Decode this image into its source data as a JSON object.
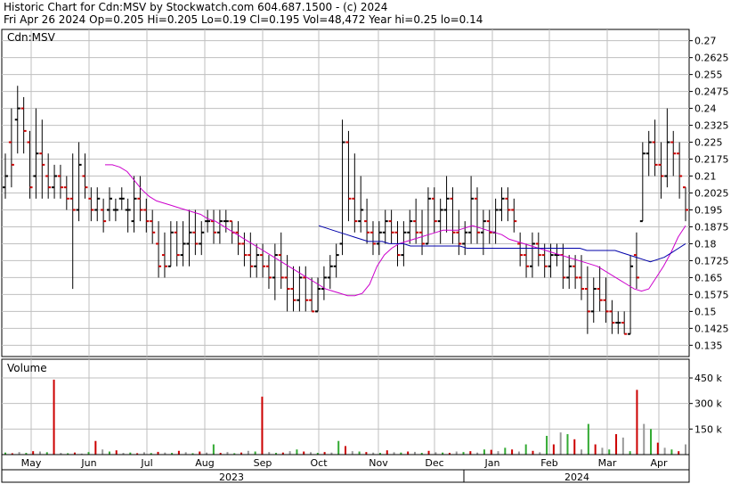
{
  "header": {
    "line1": "Historic Chart for Cdn:MSV by Stockwatch.com 604.687.1500 - (c) 2024",
    "line2": "Fri Apr 26 2024   Op=0.205  Hi=0.205  Lo=0.19  Cl=0.195  Vol=48,472  Year hi=0.25  lo=0.14"
  },
  "colors": {
    "up": "#000000",
    "down": "#cc0000",
    "ma_short": "#cc00cc",
    "ma_long": "#0000aa",
    "grid": "#bfbfbf",
    "vol_up": "#33aa33",
    "vol_down": "#cc0000",
    "vol_neutral": "#999999"
  },
  "chart_data": [
    {
      "type": "ohlc",
      "title": "Cdn:MSV",
      "ylim": [
        0.13,
        0.275
      ],
      "y_ticks": [
        "0.27",
        "0.2625",
        "0.255",
        "0.2475",
        "0.24",
        "0.2325",
        "0.225",
        "0.2175",
        "0.21",
        "0.2025",
        "0.195",
        "0.1875",
        "0.18",
        "0.1725",
        "0.165",
        "0.1575",
        "0.15",
        "0.1425",
        "0.135"
      ],
      "x_labels": [
        "May",
        "Jun",
        "Jul",
        "Aug",
        "Sep",
        "Oct",
        "Nov",
        "Dec",
        "Jan",
        "Feb",
        "Mar",
        "Apr"
      ],
      "years": [
        "2023",
        "2024"
      ],
      "bars": [
        [
          0.205,
          0.22,
          0.2,
          0.21
        ],
        [
          0.225,
          0.24,
          0.205,
          0.215
        ],
        [
          0.235,
          0.25,
          0.22,
          0.24
        ],
        [
          0.24,
          0.245,
          0.22,
          0.23
        ],
        [
          0.225,
          0.23,
          0.2,
          0.205
        ],
        [
          0.21,
          0.24,
          0.2,
          0.22
        ],
        [
          0.22,
          0.235,
          0.2,
          0.215
        ],
        [
          0.21,
          0.22,
          0.2,
          0.205
        ],
        [
          0.205,
          0.215,
          0.2,
          0.21
        ],
        [
          0.21,
          0.215,
          0.2,
          0.205
        ],
        [
          0.205,
          0.21,
          0.195,
          0.2
        ],
        [
          0.2,
          0.22,
          0.16,
          0.195
        ],
        [
          0.195,
          0.225,
          0.19,
          0.215
        ],
        [
          0.21,
          0.22,
          0.2,
          0.205
        ],
        [
          0.2,
          0.205,
          0.19,
          0.195
        ],
        [
          0.195,
          0.205,
          0.19,
          0.2
        ],
        [
          0.195,
          0.2,
          0.185,
          0.19
        ],
        [
          0.195,
          0.205,
          0.19,
          0.2
        ],
        [
          0.195,
          0.2,
          0.19,
          0.195
        ],
        [
          0.2,
          0.205,
          0.195,
          0.2
        ],
        [
          0.195,
          0.2,
          0.185,
          0.195
        ],
        [
          0.19,
          0.21,
          0.185,
          0.2
        ],
        [
          0.2,
          0.21,
          0.19,
          0.195
        ],
        [
          0.195,
          0.2,
          0.185,
          0.19
        ],
        [
          0.19,
          0.195,
          0.18,
          0.185
        ],
        [
          0.18,
          0.19,
          0.165,
          0.17
        ],
        [
          0.175,
          0.185,
          0.165,
          0.17
        ],
        [
          0.17,
          0.19,
          0.17,
          0.185
        ],
        [
          0.185,
          0.19,
          0.17,
          0.175
        ],
        [
          0.175,
          0.19,
          0.17,
          0.18
        ],
        [
          0.18,
          0.195,
          0.17,
          0.185
        ],
        [
          0.185,
          0.195,
          0.175,
          0.18
        ],
        [
          0.18,
          0.19,
          0.175,
          0.185
        ],
        [
          0.19,
          0.195,
          0.185,
          0.19
        ],
        [
          0.19,
          0.195,
          0.18,
          0.185
        ],
        [
          0.185,
          0.195,
          0.18,
          0.19
        ],
        [
          0.19,
          0.195,
          0.185,
          0.19
        ],
        [
          0.19,
          0.19,
          0.18,
          0.185
        ],
        [
          0.185,
          0.19,
          0.175,
          0.18
        ],
        [
          0.18,
          0.185,
          0.17,
          0.175
        ],
        [
          0.175,
          0.185,
          0.165,
          0.17
        ],
        [
          0.17,
          0.18,
          0.165,
          0.175
        ],
        [
          0.175,
          0.18,
          0.165,
          0.17
        ],
        [
          0.17,
          0.175,
          0.16,
          0.165
        ],
        [
          0.165,
          0.18,
          0.155,
          0.175
        ],
        [
          0.175,
          0.185,
          0.16,
          0.165
        ],
        [
          0.165,
          0.175,
          0.15,
          0.16
        ],
        [
          0.16,
          0.17,
          0.15,
          0.155
        ],
        [
          0.155,
          0.17,
          0.15,
          0.165
        ],
        [
          0.165,
          0.17,
          0.15,
          0.155
        ],
        [
          0.155,
          0.165,
          0.15,
          0.15
        ],
        [
          0.15,
          0.165,
          0.15,
          0.16
        ],
        [
          0.16,
          0.17,
          0.155,
          0.165
        ],
        [
          0.165,
          0.175,
          0.16,
          0.17
        ],
        [
          0.17,
          0.18,
          0.165,
          0.175
        ],
        [
          0.18,
          0.235,
          0.175,
          0.225
        ],
        [
          0.225,
          0.23,
          0.19,
          0.2
        ],
        [
          0.2,
          0.22,
          0.185,
          0.19
        ],
        [
          0.19,
          0.21,
          0.185,
          0.195
        ],
        [
          0.19,
          0.2,
          0.18,
          0.185
        ],
        [
          0.185,
          0.19,
          0.175,
          0.18
        ],
        [
          0.18,
          0.19,
          0.175,
          0.185
        ],
        [
          0.185,
          0.195,
          0.18,
          0.19
        ],
        [
          0.19,
          0.195,
          0.18,
          0.185
        ],
        [
          0.185,
          0.19,
          0.17,
          0.175
        ],
        [
          0.175,
          0.19,
          0.17,
          0.185
        ],
        [
          0.185,
          0.195,
          0.18,
          0.19
        ],
        [
          0.19,
          0.2,
          0.18,
          0.185
        ],
        [
          0.185,
          0.195,
          0.175,
          0.18
        ],
        [
          0.18,
          0.205,
          0.18,
          0.2
        ],
        [
          0.2,
          0.205,
          0.185,
          0.19
        ],
        [
          0.19,
          0.2,
          0.18,
          0.195
        ],
        [
          0.195,
          0.21,
          0.185,
          0.2
        ],
        [
          0.2,
          0.205,
          0.18,
          0.185
        ],
        [
          0.185,
          0.195,
          0.175,
          0.18
        ],
        [
          0.18,
          0.19,
          0.175,
          0.185
        ],
        [
          0.185,
          0.21,
          0.18,
          0.2
        ],
        [
          0.2,
          0.205,
          0.18,
          0.185
        ],
        [
          0.185,
          0.195,
          0.175,
          0.19
        ],
        [
          0.19,
          0.195,
          0.18,
          0.185
        ],
        [
          0.185,
          0.2,
          0.18,
          0.195
        ],
        [
          0.195,
          0.205,
          0.19,
          0.2
        ],
        [
          0.2,
          0.205,
          0.19,
          0.195
        ],
        [
          0.195,
          0.2,
          0.185,
          0.19
        ],
        [
          0.18,
          0.185,
          0.17,
          0.175
        ],
        [
          0.175,
          0.18,
          0.165,
          0.17
        ],
        [
          0.17,
          0.185,
          0.165,
          0.18
        ],
        [
          0.18,
          0.185,
          0.17,
          0.175
        ],
        [
          0.175,
          0.18,
          0.165,
          0.17
        ],
        [
          0.17,
          0.18,
          0.165,
          0.175
        ],
        [
          0.175,
          0.18,
          0.17,
          0.175
        ],
        [
          0.175,
          0.18,
          0.16,
          0.165
        ],
        [
          0.165,
          0.175,
          0.16,
          0.17
        ],
        [
          0.17,
          0.175,
          0.16,
          0.165
        ],
        [
          0.165,
          0.175,
          0.155,
          0.16
        ],
        [
          0.16,
          0.17,
          0.14,
          0.15
        ],
        [
          0.15,
          0.165,
          0.145,
          0.16
        ],
        [
          0.16,
          0.17,
          0.15,
          0.155
        ],
        [
          0.155,
          0.165,
          0.145,
          0.15
        ],
        [
          0.15,
          0.155,
          0.14,
          0.145
        ],
        [
          0.145,
          0.15,
          0.14,
          0.145
        ],
        [
          0.145,
          0.15,
          0.14,
          0.14
        ],
        [
          0.14,
          0.175,
          0.14,
          0.17
        ],
        [
          0.175,
          0.185,
          0.16,
          0.165
        ],
        [
          0.19,
          0.225,
          0.19,
          0.22
        ],
        [
          0.22,
          0.23,
          0.21,
          0.225
        ],
        [
          0.225,
          0.235,
          0.21,
          0.215
        ],
        [
          0.215,
          0.225,
          0.2,
          0.21
        ],
        [
          0.21,
          0.24,
          0.205,
          0.225
        ],
        [
          0.225,
          0.23,
          0.21,
          0.22
        ],
        [
          0.22,
          0.225,
          0.2,
          0.21
        ],
        [
          0.205,
          0.205,
          0.19,
          0.195
        ]
      ],
      "ma_short": [
        0.215,
        0.215,
        0.214,
        0.212,
        0.208,
        0.204,
        0.201,
        0.199,
        0.198,
        0.197,
        0.196,
        0.195,
        0.194,
        0.193,
        0.191,
        0.19,
        0.188,
        0.186,
        0.184,
        0.182,
        0.18,
        0.178,
        0.176,
        0.174,
        0.172,
        0.17,
        0.168,
        0.166,
        0.164,
        0.162,
        0.16,
        0.159,
        0.158,
        0.157,
        0.157,
        0.158,
        0.162,
        0.17,
        0.175,
        0.178,
        0.18,
        0.181,
        0.182,
        0.183,
        0.184,
        0.185,
        0.186,
        0.186,
        0.186,
        0.187,
        0.188,
        0.187,
        0.186,
        0.185,
        0.184,
        0.182,
        0.181,
        0.18,
        0.179,
        0.178,
        0.177,
        0.176,
        0.175,
        0.174,
        0.173,
        0.172,
        0.171,
        0.17,
        0.168,
        0.166,
        0.164,
        0.162,
        0.16,
        0.159,
        0.16,
        0.165,
        0.17,
        0.176,
        0.183,
        0.188
      ],
      "ma_long": [
        0.188,
        0.187,
        0.186,
        0.185,
        0.184,
        0.183,
        0.182,
        0.181,
        0.181,
        0.181,
        0.18,
        0.18,
        0.18,
        0.179,
        0.179,
        0.179,
        0.179,
        0.179,
        0.179,
        0.179,
        0.179,
        0.178,
        0.178,
        0.178,
        0.178,
        0.178,
        0.178,
        0.178,
        0.178,
        0.178,
        0.178,
        0.178,
        0.178,
        0.178,
        0.178,
        0.178,
        0.178,
        0.178,
        0.177,
        0.177,
        0.177,
        0.177,
        0.177,
        0.176,
        0.175,
        0.174,
        0.173,
        0.172,
        0.173,
        0.174,
        0.176,
        0.178,
        0.18
      ]
    },
    {
      "type": "bar",
      "title": "Volume",
      "ylim": [
        0,
        560
      ],
      "y_ticks": [
        "450 k",
        "300 k",
        "150 k"
      ],
      "unit": "k",
      "values": [
        12,
        8,
        15,
        10,
        20,
        18,
        14,
        440,
        10,
        8,
        12,
        6,
        15,
        80,
        30,
        18,
        25,
        10,
        12,
        8,
        14,
        9,
        16,
        12,
        10,
        22,
        14,
        8,
        18,
        12,
        60,
        10,
        15,
        8,
        12,
        22,
        18,
        340,
        15,
        10,
        12,
        20,
        30,
        18,
        14,
        10,
        15,
        12,
        80,
        50,
        20,
        18,
        15,
        12,
        10,
        25,
        14,
        12,
        18,
        16,
        10,
        22,
        14,
        12,
        10,
        18,
        15,
        20,
        12,
        30,
        28,
        20,
        40,
        30,
        18,
        60,
        22,
        14,
        110,
        60,
        130,
        120,
        90,
        30,
        180,
        60,
        40,
        30,
        120,
        100,
        20,
        380,
        180,
        150,
        70,
        40,
        30,
        20,
        60
      ]
    }
  ]
}
